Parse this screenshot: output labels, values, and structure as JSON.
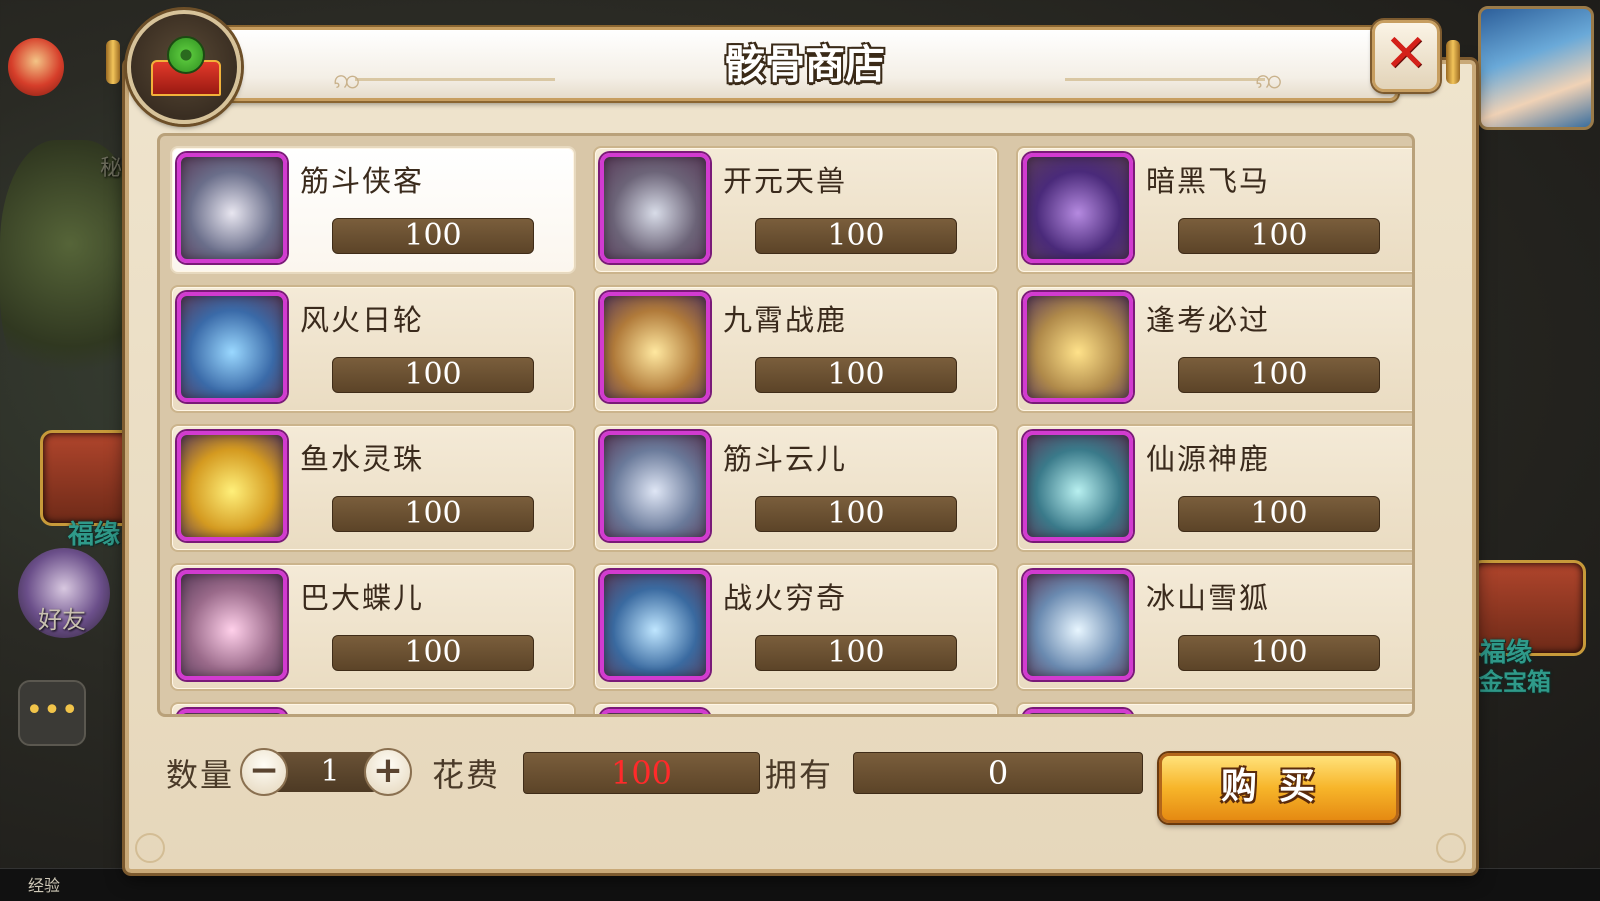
{
  "shop": {
    "title": "骸骨商店",
    "items": [
      {
        "name": "筋斗侠客",
        "price": "100",
        "icon": "mount-icon-jindou-xiake",
        "c1": "#e8e6f0",
        "c2": "#6a6e8a",
        "selected": true
      },
      {
        "name": "开元天兽",
        "price": "100",
        "icon": "mount-icon-kaiyuan-tianshou",
        "c1": "#d8dce8",
        "c2": "#6c6478"
      },
      {
        "name": "暗黑飞马",
        "price": "100",
        "icon": "mount-icon-anhei-feima",
        "c1": "#b58ae0",
        "c2": "#4a2a7a"
      },
      {
        "name": "风火日轮",
        "price": "100",
        "icon": "mount-icon-fenghuo-rilun",
        "c1": "#9ad8ff",
        "c2": "#3a6aa8"
      },
      {
        "name": "九霄战鹿",
        "price": "100",
        "icon": "mount-icon-jiuxiao-zhanlu",
        "c1": "#ffe8a0",
        "c2": "#b07a3a"
      },
      {
        "name": "逢考必过",
        "price": "100",
        "icon": "mount-icon-fengkao-biguo",
        "c1": "#ffe28a",
        "c2": "#b08a4a"
      },
      {
        "name": "鱼水灵珠",
        "price": "100",
        "icon": "mount-icon-yushui-lingzhu",
        "c1": "#fff07a",
        "c2": "#d49a20"
      },
      {
        "name": "筋斗云儿",
        "price": "100",
        "icon": "mount-icon-jindou-yuner",
        "c1": "#dfe6f5",
        "c2": "#6a7a9a"
      },
      {
        "name": "仙源神鹿",
        "price": "100",
        "icon": "mount-icon-xianyuan-shenlu",
        "c1": "#b8f0f0",
        "c2": "#3a7a8a"
      },
      {
        "name": "巴大蝶儿",
        "price": "100",
        "icon": "mount-icon-bada-dieer",
        "c1": "#ffd0ea",
        "c2": "#9a6a8a"
      },
      {
        "name": "战火穷奇",
        "price": "100",
        "icon": "mount-icon-zhanhuo-qiongqi",
        "c1": "#bfe6ff",
        "c2": "#3a6aa0"
      },
      {
        "name": "冰山雪狐",
        "price": "100",
        "icon": "mount-icon-bingshan-xuehu",
        "c1": "#e8f6ff",
        "c2": "#6a8ab0"
      }
    ]
  },
  "purchase": {
    "quantity_label": "数量",
    "quantity": "1",
    "minus_symbol": "−",
    "plus_symbol": "+",
    "cost_label": "花费",
    "cost": "100",
    "owned_label": "拥有",
    "owned": "0",
    "buy_label": "购买"
  },
  "background": {
    "hud_labels": [
      "福缘",
      "赤金宝箱",
      "好友",
      "秘",
      "经验"
    ]
  },
  "colors": {
    "cost_text": "#ff2a2a",
    "owned_text": "#ffffff",
    "icon_border": "#d23bd0",
    "panel_bg": "#efe4cd"
  }
}
